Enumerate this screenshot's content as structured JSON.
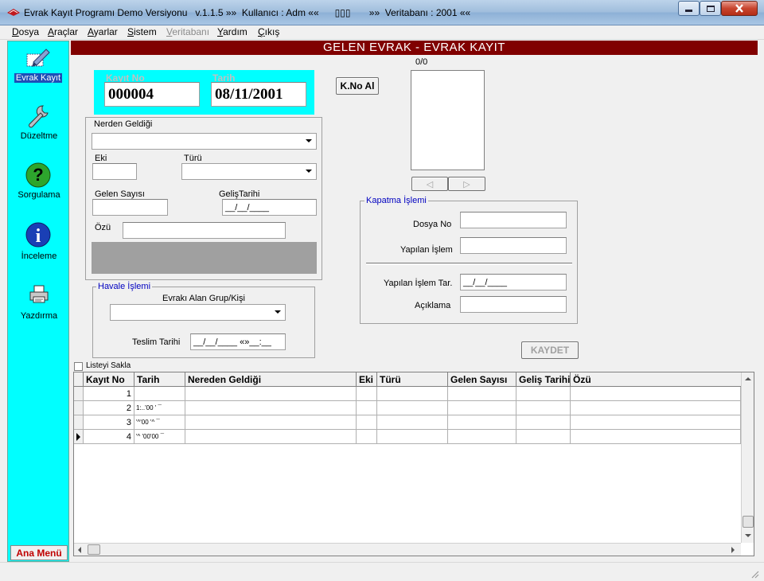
{
  "window": {
    "title": "Evrak Kayıt Programı Demo Versiyonu   v.1.1.5 »»  Kullanıcı : Adm ««      ▯▯▯       »»  Veritabanı : 2001 ««"
  },
  "menu": [
    "Dosya",
    "Araçlar",
    "Ayarlar",
    "Sistem",
    "Veritabanı",
    "Yardım",
    "Çıkış"
  ],
  "sidebar": {
    "items": [
      {
        "label": "Evrak Kayıt",
        "icon": "pen-icon"
      },
      {
        "label": "Düzeltme",
        "icon": "wrench-icon"
      },
      {
        "label": "Sorgulama",
        "icon": "question-icon"
      },
      {
        "label": "İnceleme",
        "icon": "info-icon"
      },
      {
        "label": "Yazdırma",
        "icon": "printer-icon"
      }
    ],
    "main_menu": "Ana Menü"
  },
  "header": {
    "title": "GELEN EVRAK - EVRAK KAYIT"
  },
  "record": {
    "kayit_no_label": "Kayıt No",
    "kayit_no": "000004",
    "tarih_label": "Tarih",
    "tarih": "08/11/2001",
    "kno_button": "K.No Al"
  },
  "form": {
    "nerden_label": "Nerden Geldiği",
    "eki_label": "Eki",
    "turu_label": "Türü",
    "gelen_sayisi_label": "Gelen Sayısı",
    "gelis_tarihi_label": "GelişTarihi",
    "gelis_tarihi_value": "__/__/____",
    "ozu_label": "Özü"
  },
  "havale": {
    "title": "Havale İşlemi",
    "evraki_alan_label": "Evrakı Alan Grup/Kişi",
    "teslim_label": "Teslim Tarihi",
    "teslim_value": "__/__/____ «»__:__"
  },
  "preview": {
    "counter": "0/0",
    "prev": "◁",
    "next": "▷"
  },
  "kapatma": {
    "title": "Kapatma İşlemi",
    "dosya_no_label": "Dosya No",
    "yapilan_islem_label": "Yapılan İşlem",
    "yapilan_islem_tar_label": "Yapılan İşlem Tar.",
    "yapilan_islem_tar_value": "__/__/____",
    "aciklama_label": "Açıklama"
  },
  "kaydet_button": "KAYDET",
  "listeyi_sakla": "Listeyi Sakla",
  "grid": {
    "columns": [
      "Kayıt No",
      "Tarih",
      "Nereden Geldiği",
      "Eki",
      "Türü",
      "Gelen Sayısı",
      "Geliş Tarihi",
      "Özü"
    ],
    "rows": [
      {
        "kayit_no": "1",
        "tarih": ""
      },
      {
        "kayit_no": "2",
        "tarih": "1:..'00  '   ¯"
      },
      {
        "kayit_no": "3",
        "tarih": "'^'00 '^   ¯"
      },
      {
        "kayit_no": "4",
        "tarih": "'^  '00'00  ¯"
      }
    ]
  }
}
